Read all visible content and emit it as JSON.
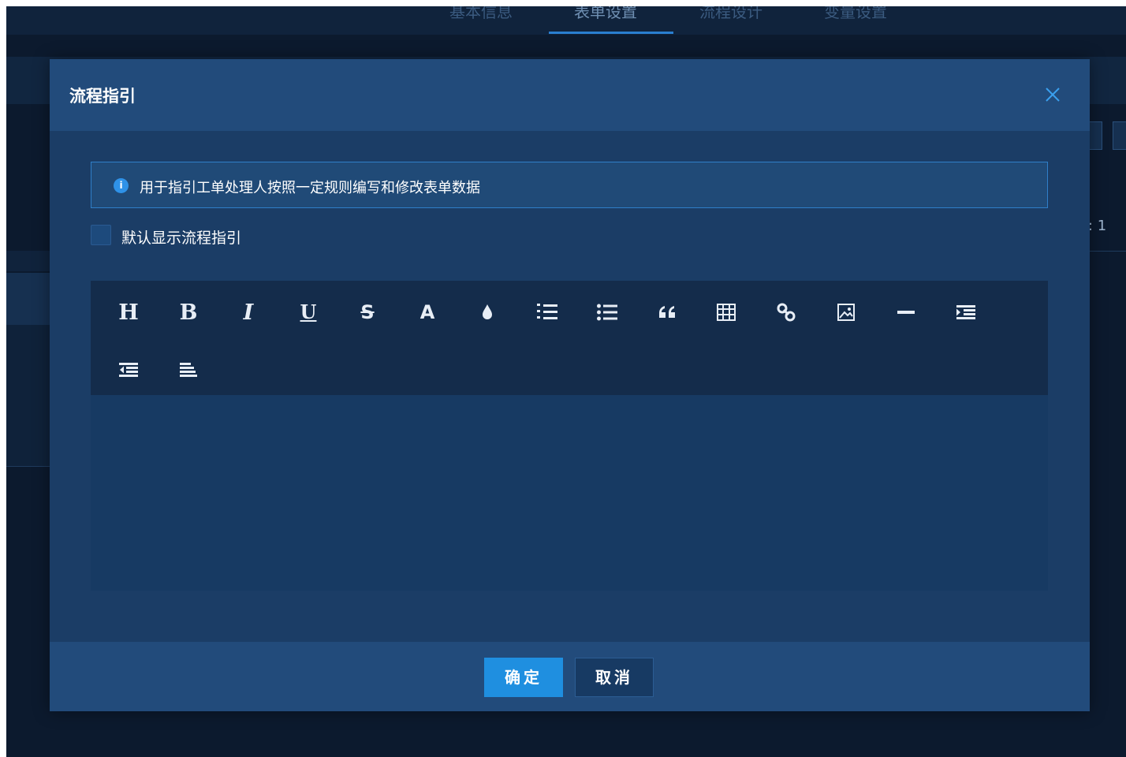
{
  "background": {
    "tabs": [
      "基本信息",
      "表单设置",
      "流程设计",
      "变量设置"
    ],
    "active_tab": "表单设置",
    "right_text": ": 1"
  },
  "dialog": {
    "title": "流程指引",
    "close_icon": "close-icon",
    "info_text": "用于指引工单处理人按照一定规则编写和修改表单数据",
    "checkbox_label": "默认显示流程指引",
    "checkbox_checked": false,
    "editor": {
      "toolbar": [
        {
          "name": "heading",
          "icon": "heading-icon"
        },
        {
          "name": "bold",
          "icon": "bold-icon"
        },
        {
          "name": "italic",
          "icon": "italic-icon"
        },
        {
          "name": "underline",
          "icon": "underline-icon"
        },
        {
          "name": "strikethrough",
          "icon": "strikethrough-icon"
        },
        {
          "name": "font-color",
          "icon": "font-color-icon"
        },
        {
          "name": "background-color",
          "icon": "drop-icon"
        },
        {
          "name": "ordered-list",
          "icon": "ordered-list-icon"
        },
        {
          "name": "unordered-list",
          "icon": "unordered-list-icon"
        },
        {
          "name": "quote",
          "icon": "quote-icon"
        },
        {
          "name": "table",
          "icon": "table-icon"
        },
        {
          "name": "link",
          "icon": "link-icon"
        },
        {
          "name": "image",
          "icon": "image-icon"
        },
        {
          "name": "divider",
          "icon": "divider-icon"
        },
        {
          "name": "indent",
          "icon": "indent-icon"
        },
        {
          "name": "outdent",
          "icon": "outdent-icon"
        },
        {
          "name": "align",
          "icon": "align-left-icon"
        }
      ],
      "content": ""
    },
    "ok_label": "确定",
    "cancel_label": "取消"
  },
  "colors": {
    "page_bg": "#0c1a2e",
    "modal_bg": "#1b3d66",
    "header_bg": "#224b7b",
    "accent": "#1f8fe0",
    "close_color": "#3aa0ef"
  }
}
